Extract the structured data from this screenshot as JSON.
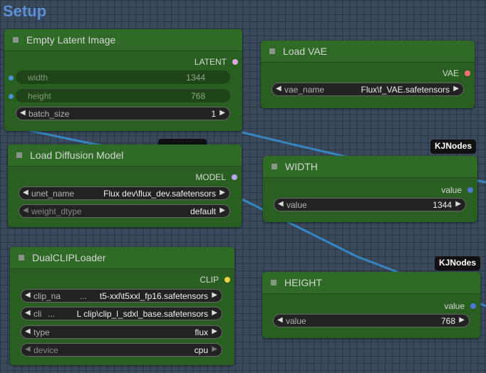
{
  "group": {
    "title": "Setup"
  },
  "badges": {
    "width_badge": "KJNodes",
    "height_badge": "KJNodes"
  },
  "colors": {
    "latent_dot": "#e0a8e0",
    "vae_dot": "#ff6e6e",
    "model_dot": "#b8a6e8",
    "clip_dot": "#f2d24a",
    "int_dot": "#4a7ad6",
    "link": "#3a8fd0"
  },
  "nodes": {
    "empty_latent": {
      "title": "Empty Latent Image",
      "output": "LATENT",
      "width": {
        "name": "width",
        "value": "1344"
      },
      "height": {
        "name": "height",
        "value": "768"
      },
      "batch_size": {
        "name": "batch_size",
        "value": "1"
      }
    },
    "load_vae": {
      "title": "Load VAE",
      "output": "VAE",
      "vae_name": {
        "name": "vae_name",
        "value": "Flux\\f_VAE.safetensors"
      }
    },
    "load_diffusion": {
      "title": "Load Diffusion Model",
      "output": "MODEL",
      "unet_name": {
        "name": "unet_name",
        "value": "Flux dev\\flux_dev.safetensors"
      },
      "weight_dtype": {
        "name": "weight_dtype",
        "value": "default"
      }
    },
    "width_node": {
      "title": "WIDTH",
      "output": "value",
      "value": {
        "name": "value",
        "value": "1344"
      }
    },
    "dual_clip": {
      "title": "DualCLIPLoader",
      "output": "CLIP",
      "clip_name1": {
        "name": "clip_na",
        "ellipsis": "...",
        "value": "t5-xxl\\t5xxl_fp16.safetensors"
      },
      "clip_name2": {
        "name": "cli",
        "ellipsis": "...",
        "value": "L clip\\clip_l_sdxl_base.safetensors"
      },
      "type": {
        "name": "type",
        "value": "flux"
      },
      "device": {
        "name": "device",
        "value": "cpu"
      }
    },
    "height_node": {
      "title": "HEIGHT",
      "output": "value",
      "value": {
        "name": "value",
        "value": "768"
      }
    }
  }
}
